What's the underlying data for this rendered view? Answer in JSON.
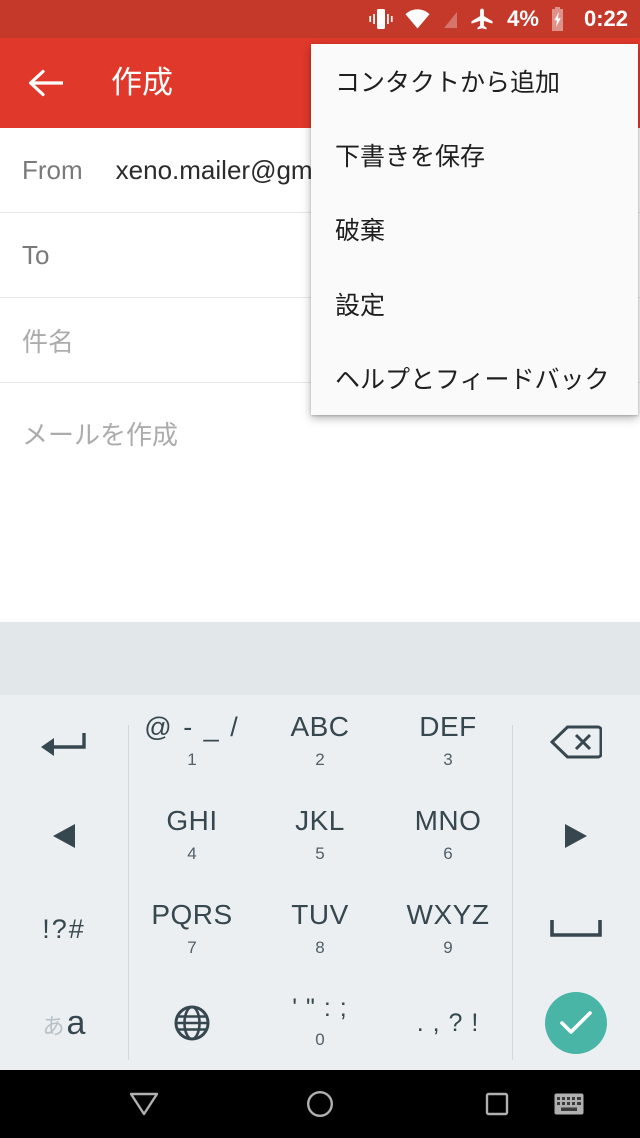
{
  "statusbar": {
    "battery_percent": "4%",
    "time": "0:22",
    "icons": [
      "vibrate-icon",
      "wifi-icon",
      "no-signal-icon",
      "airplane-mode-icon",
      "battery-charging-icon"
    ],
    "background_color": "#C5392B"
  },
  "appbar": {
    "title": "作成",
    "back_icon": "arrow-left-icon",
    "background_color": "#E0392B"
  },
  "compose": {
    "from_label": "From",
    "from_value": "xeno.mailer@gma",
    "to_label": "To",
    "to_value": "",
    "subject_placeholder": "件名",
    "body_placeholder": "メールを作成"
  },
  "menu": {
    "items": [
      {
        "label": "コンタクトから追加"
      },
      {
        "label": "下書きを保存"
      },
      {
        "label": "破棄"
      },
      {
        "label": "設定"
      },
      {
        "label": "ヘルプとフィードバック"
      }
    ]
  },
  "keyboard": {
    "accent_color": "#48b5a7",
    "background_color": "#ebeff1",
    "suggestion_bar_color": "#e2e7ea",
    "rows": [
      [
        {
          "name": "undo-key",
          "main": "",
          "sub": "",
          "icon": "undo-arrow-icon"
        },
        {
          "name": "key-1",
          "main": "@ - _ /",
          "sub": "1",
          "icon": ""
        },
        {
          "name": "key-2",
          "main": "ABC",
          "sub": "2",
          "icon": ""
        },
        {
          "name": "key-3",
          "main": "DEF",
          "sub": "3",
          "icon": ""
        },
        {
          "name": "backspace-key",
          "main": "",
          "sub": "",
          "icon": "backspace-icon"
        }
      ],
      [
        {
          "name": "cursor-left-key",
          "main": "",
          "sub": "",
          "icon": "triangle-left-icon"
        },
        {
          "name": "key-4",
          "main": "GHI",
          "sub": "4",
          "icon": ""
        },
        {
          "name": "key-5",
          "main": "JKL",
          "sub": "5",
          "icon": ""
        },
        {
          "name": "key-6",
          "main": "MNO",
          "sub": "6",
          "icon": ""
        },
        {
          "name": "cursor-right-key",
          "main": "",
          "sub": "",
          "icon": "triangle-right-icon"
        }
      ],
      [
        {
          "name": "symbols-key",
          "main": "!?#",
          "sub": "",
          "icon": ""
        },
        {
          "name": "key-7",
          "main": "PQRS",
          "sub": "7",
          "icon": ""
        },
        {
          "name": "key-8",
          "main": "TUV",
          "sub": "8",
          "icon": ""
        },
        {
          "name": "key-9",
          "main": "WXYZ",
          "sub": "9",
          "icon": ""
        },
        {
          "name": "space-key",
          "main": "",
          "sub": "",
          "icon": "space-bar-icon"
        }
      ],
      [
        {
          "name": "language-toggle-key",
          "main": "",
          "sub": "",
          "icon": "kana-latin-icon",
          "kana": "あ",
          "latin": "a"
        },
        {
          "name": "globe-key",
          "main": "",
          "sub": "",
          "icon": "globe-icon"
        },
        {
          "name": "key-0",
          "main": "' \" : ;",
          "sub": "0",
          "icon": ""
        },
        {
          "name": "punctuation-key",
          "main": ". , ? !",
          "sub": "",
          "icon": ""
        },
        {
          "name": "enter-key",
          "main": "",
          "sub": "",
          "icon": "check-icon"
        }
      ]
    ]
  },
  "navbar": {
    "back_icon": "triangle-down-icon",
    "home_icon": "circle-icon",
    "recents_icon": "square-icon",
    "keyboard_icon": "keyboard-icon",
    "background_color": "#000000"
  }
}
